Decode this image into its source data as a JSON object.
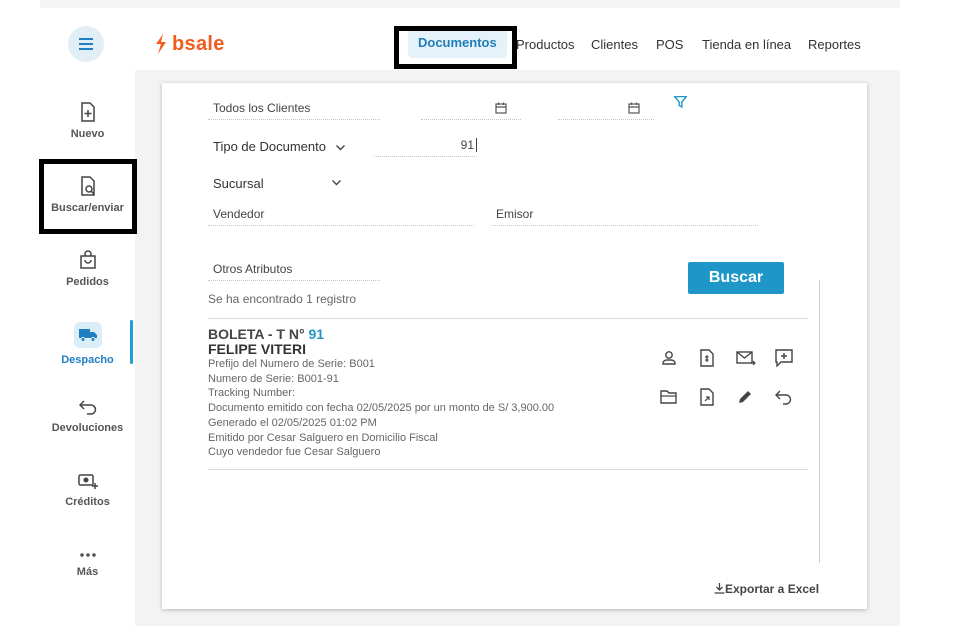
{
  "brand": {
    "name": "bsale",
    "color": "#f25c1d",
    "accent": "#1e97c8"
  },
  "topnav": {
    "items": [
      {
        "label": "Documentos",
        "active": true
      },
      {
        "label": "Productos"
      },
      {
        "label": "Clientes"
      },
      {
        "label": "POS"
      },
      {
        "label": "Tienda en línea"
      },
      {
        "label": "Reportes"
      }
    ]
  },
  "sidebar": {
    "items": [
      {
        "label": "Nuevo",
        "icon": "file-plus-icon"
      },
      {
        "label": "Buscar/enviar",
        "icon": "file-search-icon"
      },
      {
        "label": "Pedidos",
        "icon": "shopping-bag-icon"
      },
      {
        "label": "Despacho",
        "icon": "truck-icon",
        "active": true
      },
      {
        "label": "Devoluciones",
        "icon": "return-arrow-icon"
      },
      {
        "label": "Créditos",
        "icon": "money-plus-icon"
      },
      {
        "label": "Más",
        "icon": "more-dots-icon"
      }
    ]
  },
  "filters": {
    "clientes": "Todos los Clientes",
    "tipo_documento": "Tipo de Documento",
    "numero": "91",
    "sucursal": "Sucursal",
    "vendedor": "Vendedor",
    "emisor": "Emisor",
    "otros_atributos": "Otros Atributos",
    "buscar_label": "Buscar"
  },
  "results": {
    "summary": "Se ha encontrado 1 registro",
    "document": {
      "type_label": "BOLETA - T N°",
      "number": "91",
      "client": "FELIPE VITERI",
      "lines": [
        "Prefijo del Numero de Serie: B001",
        "Numero de Serie: B001-91",
        "Tracking Number:",
        "Documento emitido con fecha 02/05/2025 por un monto de S/ 3,900.00",
        "Generado el 02/05/2025 01:02 PM",
        "Emitido por Cesar Salguero en Domicilio Fiscal",
        "Cuyo vendedor fue Cesar Salguero"
      ]
    },
    "actions": [
      "user-icon",
      "document-money-icon",
      "email-send-icon",
      "comment-plus-icon",
      "folder-open-icon",
      "document-link-icon",
      "pencil-icon",
      "undo-arrow-icon"
    ]
  },
  "export_label": "Exportar a Excel"
}
